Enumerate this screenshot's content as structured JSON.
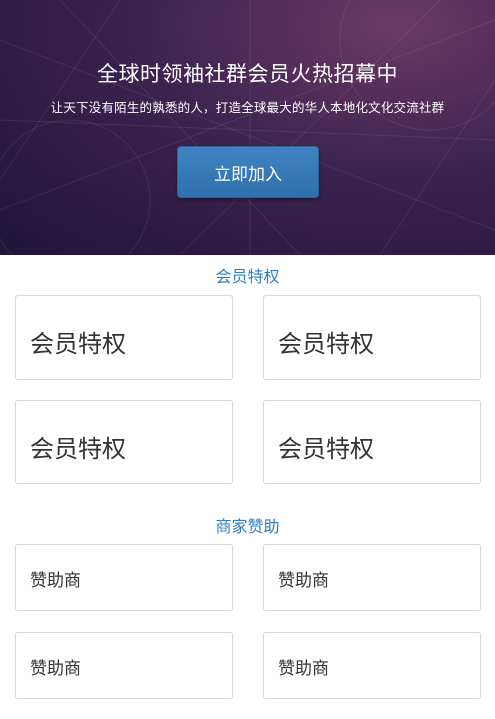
{
  "hero": {
    "title": "全球时领袖社群会员火热招幕中",
    "subtitle": "让天下没有陌生的孰悉的人，打造全球最大的华人本地化文化交流社群",
    "join_button_label": "立即加入"
  },
  "privileges": {
    "section_title": "会员特权",
    "cards": [
      {
        "label": "会员特权"
      },
      {
        "label": "会员特权"
      },
      {
        "label": "会员特权"
      },
      {
        "label": "会员特权"
      }
    ]
  },
  "sponsors": {
    "section_title": "商家赞助",
    "cards": [
      {
        "label": "赞助商"
      },
      {
        "label": "赞助商"
      },
      {
        "label": "赞助商"
      },
      {
        "label": "赞助商"
      }
    ]
  },
  "colors": {
    "accent": "#2f7ec1",
    "button": "#3479b8",
    "hero_dark": "#1e1538",
    "hero_light": "#6a3a63",
    "card_border": "#d7d7d7"
  }
}
